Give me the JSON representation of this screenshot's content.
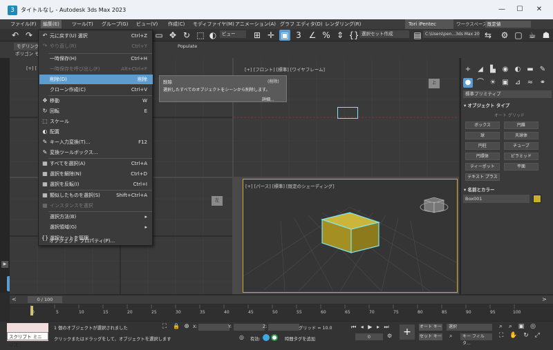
{
  "window": {
    "title": "タイトルなし - Autodesk 3ds Max 2023",
    "minimize": "—",
    "maximize": "☐",
    "close": "✕"
  },
  "menubar": {
    "items": [
      "ファイル(F)",
      "編集(E)",
      "ツール(T)",
      "グループ(G)",
      "ビュー(V)",
      "作成(C)",
      "モディファイヤ(M)",
      "アニメーション(A)",
      "グラフ エディタ(D)",
      "レンダリング(R)"
    ],
    "user": "Tori iPentec",
    "workspace_label": "ワークスペース:",
    "workspace_value": "既定値"
  },
  "toolbar": {
    "view_dropdown": "ビュー",
    "selection_set": "選択セット作成",
    "path": "C:\\Users\\pen...3ds Max 2023"
  },
  "ribbon": {
    "tabs": [
      "モデリング",
      "ポリゴン モデ"
    ],
    "populate": "Populate"
  },
  "viewports": {
    "top_left": "[+] [",
    "front": "[+] [フロント] [標準] [ワイヤフレーム]",
    "perspective": "[+] [パース] [標準] [既定のシェーディング]",
    "cube_labels": [
      "上",
      "前",
      "左"
    ]
  },
  "context_menu": {
    "items": [
      {
        "icon": "↶",
        "label": "元に戻す(U) 選択",
        "shortcut": "Ctrl+Z",
        "disabled": false
      },
      {
        "icon": "↷",
        "label": "やり直し(R)",
        "shortcut": "Ctrl+Y",
        "disabled": true
      },
      {
        "icon": "",
        "label": "一時保存(H)",
        "shortcut": "Ctrl+H",
        "disabled": false
      },
      {
        "icon": "",
        "label": "一時保存を呼び出し(F)",
        "shortcut": "Alt+Ctrl+F",
        "disabled": true
      },
      {
        "icon": "✕",
        "label": "削除(D)",
        "shortcut": "削除",
        "disabled": false
      },
      {
        "icon": "",
        "label": "クローン作成(C)",
        "shortcut": "Ctrl+V",
        "disabled": false
      },
      {
        "icon": "✥",
        "label": "移動",
        "shortcut": "W",
        "disabled": false
      },
      {
        "icon": "↻",
        "label": "回転",
        "shortcut": "E",
        "disabled": false
      },
      {
        "icon": "⬚",
        "label": "スケール",
        "shortcut": "",
        "disabled": false
      },
      {
        "icon": "◐",
        "label": "配置",
        "shortcut": "",
        "disabled": false
      },
      {
        "icon": "✎",
        "label": "キー入力変換(T)...",
        "shortcut": "F12",
        "disabled": false
      },
      {
        "icon": "✎",
        "label": "変換ツールボックス...",
        "shortcut": "",
        "disabled": false
      },
      {
        "icon": "▦",
        "label": "すべてを選択(A)",
        "shortcut": "Ctrl+A",
        "disabled": false
      },
      {
        "icon": "▦",
        "label": "選択を解除(N)",
        "shortcut": "Ctrl+D",
        "disabled": false
      },
      {
        "icon": "▦",
        "label": "選択を反転(I)",
        "shortcut": "Ctrl+I",
        "disabled": false
      },
      {
        "icon": "▦",
        "label": "類似したものを選択(S)",
        "shortcut": "Shift+Ctrl+A",
        "disabled": false
      },
      {
        "icon": "▦",
        "label": "インスタンスを選択",
        "shortcut": "",
        "disabled": true
      },
      {
        "icon": "",
        "label": "選択方法(B)",
        "shortcut": "▸",
        "disabled": false
      },
      {
        "icon": "",
        "label": "選択領域(G)",
        "shortcut": "▸",
        "disabled": false
      },
      {
        "icon": "{}",
        "label": "選択セットを管理...",
        "shortcut": "",
        "disabled": false
      },
      {
        "icon": "",
        "label": "オブジェクト プロパティ(P)...",
        "shortcut": "",
        "disabled": false
      }
    ]
  },
  "tooltip": {
    "title": "削除",
    "shortcut": "(削除)",
    "description": "選択したすべてのオブジェクトをシーンから削除します。",
    "more": "詳細..."
  },
  "command_panel": {
    "category": "標準プリミティブ",
    "object_type_title": "オブジェクト タイプ",
    "autogrid": "オート グリッド",
    "buttons": [
      "ボックス",
      "円錐",
      "球",
      "天球体",
      "円柱",
      "チューブ",
      "円環体",
      "ピラミッド",
      "ティーポット",
      "平面",
      "テキスト プラス"
    ],
    "name_color_title": "名前とカラー",
    "object_name": "Box001",
    "object_color": "#c9b02b"
  },
  "timeline": {
    "slider": "0 / 100",
    "ticks": [
      "0",
      "5",
      "10",
      "15",
      "20",
      "25",
      "30",
      "35",
      "40",
      "45",
      "50",
      "55",
      "60",
      "65",
      "70",
      "75",
      "80",
      "85",
      "90",
      "95",
      "100"
    ]
  },
  "status": {
    "script_label": "スクリプト ミニ リス",
    "selected": "1 個のオブジェクトが選択されました",
    "hint": "クリックまたはドラッグをして、オブジェクトを選択します",
    "x_label": "X:",
    "y_label": "Y:",
    "z_label": "Z:",
    "grid": "グリッド = 10.0",
    "enabled": "有効:",
    "add_time_tag": "時間タグを追加",
    "autokey": "オート キー",
    "setkey": "セット キー",
    "selected_dd": "選択",
    "key_filter": "キー フィルタ...",
    "frame": "0"
  }
}
